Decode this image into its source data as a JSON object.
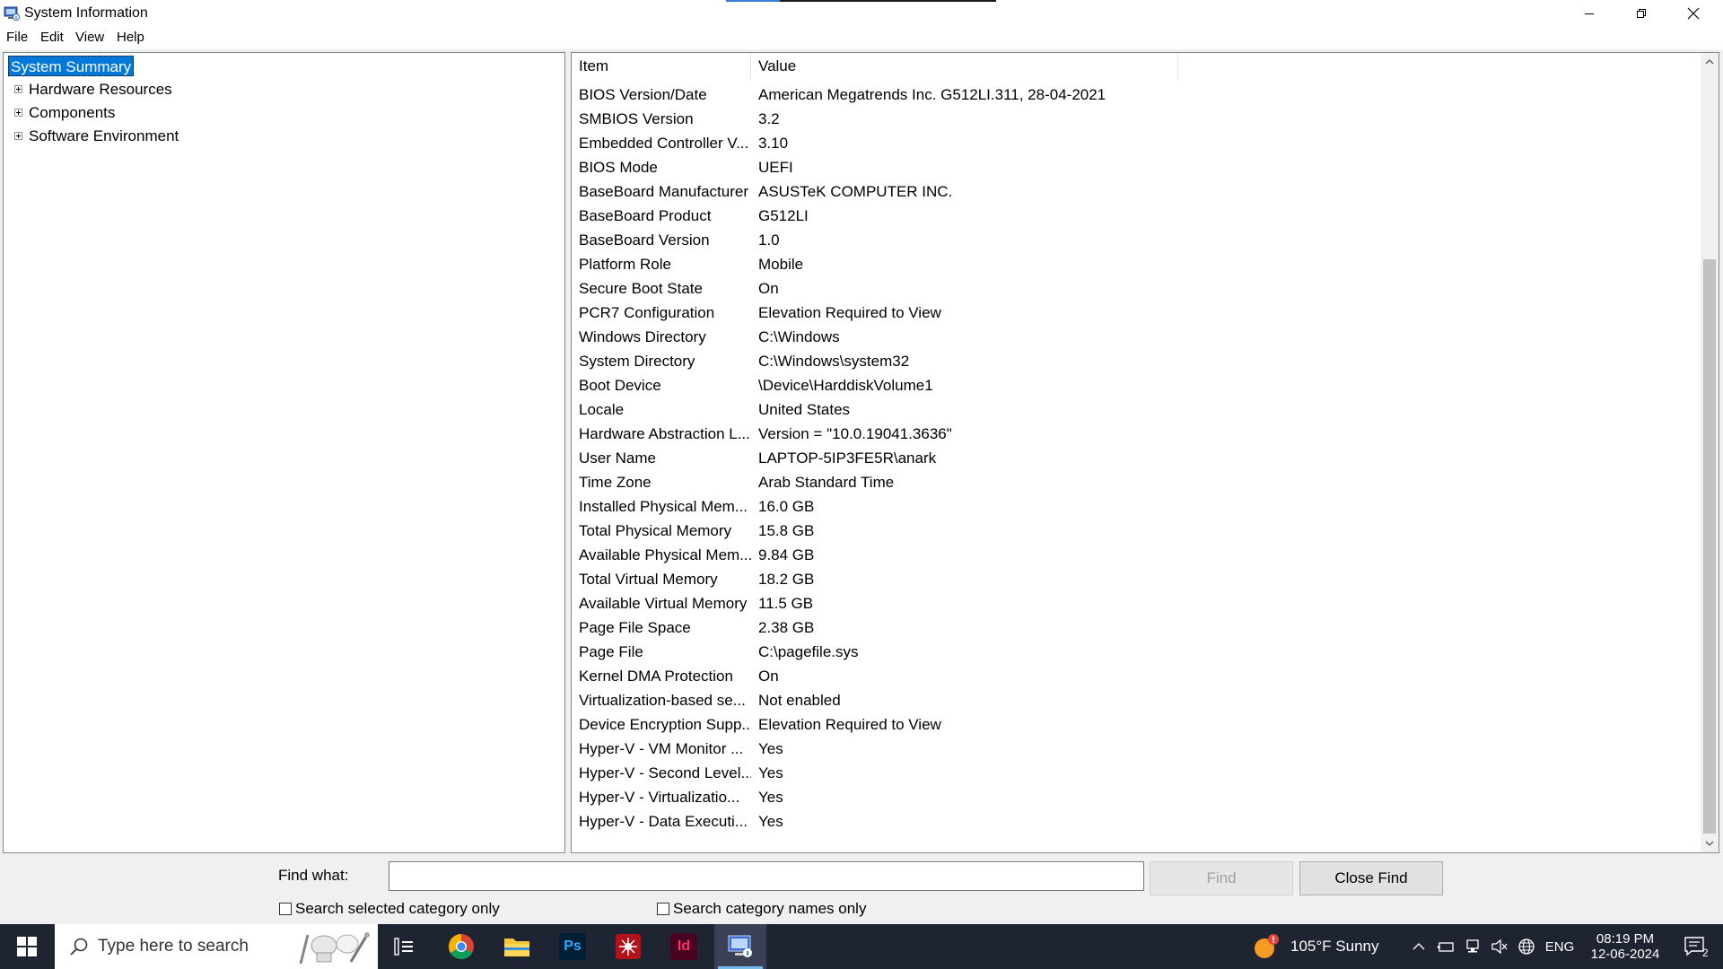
{
  "window": {
    "title": "System Information",
    "minimize": "—",
    "maximize": "❐",
    "close": "✕"
  },
  "menu": {
    "items": [
      "File",
      "Edit",
      "View",
      "Help"
    ]
  },
  "tree": {
    "root": "System Summary",
    "children": [
      "Hardware Resources",
      "Components",
      "Software Environment"
    ]
  },
  "list": {
    "headers": {
      "item": "Item",
      "value": "Value"
    },
    "rows": [
      {
        "item": "BIOS Version/Date",
        "value": "American Megatrends Inc. G512LI.311, 28-04-2021"
      },
      {
        "item": "SMBIOS Version",
        "value": "3.2"
      },
      {
        "item": "Embedded Controller V...",
        "value": "3.10"
      },
      {
        "item": "BIOS Mode",
        "value": "UEFI"
      },
      {
        "item": "BaseBoard Manufacturer",
        "value": "ASUSTeK COMPUTER INC."
      },
      {
        "item": "BaseBoard Product",
        "value": "G512LI"
      },
      {
        "item": "BaseBoard Version",
        "value": "1.0"
      },
      {
        "item": "Platform Role",
        "value": "Mobile"
      },
      {
        "item": "Secure Boot State",
        "value": "On"
      },
      {
        "item": "PCR7 Configuration",
        "value": "Elevation Required to View"
      },
      {
        "item": "Windows Directory",
        "value": "C:\\Windows"
      },
      {
        "item": "System Directory",
        "value": "C:\\Windows\\system32"
      },
      {
        "item": "Boot Device",
        "value": "\\Device\\HarddiskVolume1"
      },
      {
        "item": "Locale",
        "value": "United States"
      },
      {
        "item": "Hardware Abstraction L...",
        "value": "Version = \"10.0.19041.3636\""
      },
      {
        "item": "User Name",
        "value": "LAPTOP-5IP3FE5R\\anark"
      },
      {
        "item": "Time Zone",
        "value": "Arab Standard Time"
      },
      {
        "item": "Installed Physical Mem...",
        "value": "16.0 GB"
      },
      {
        "item": "Total Physical Memory",
        "value": "15.8 GB"
      },
      {
        "item": "Available Physical Mem...",
        "value": "9.84 GB"
      },
      {
        "item": "Total Virtual Memory",
        "value": "18.2 GB"
      },
      {
        "item": "Available Virtual Memory",
        "value": "11.5 GB"
      },
      {
        "item": "Page File Space",
        "value": "2.38 GB"
      },
      {
        "item": "Page File",
        "value": "C:\\pagefile.sys"
      },
      {
        "item": "Kernel DMA Protection",
        "value": "On"
      },
      {
        "item": "Virtualization-based se...",
        "value": "Not enabled"
      },
      {
        "item": "Device Encryption Supp...",
        "value": "Elevation Required to View"
      },
      {
        "item": "Hyper-V - VM Monitor ...",
        "value": "Yes"
      },
      {
        "item": "Hyper-V - Second Level...",
        "value": "Yes"
      },
      {
        "item": "Hyper-V - Virtualizatio...",
        "value": "Yes"
      },
      {
        "item": "Hyper-V - Data Executi...",
        "value": "Yes"
      }
    ]
  },
  "find": {
    "label": "Find what:",
    "value": "",
    "find_button": "Find",
    "close_find_button": "Close Find",
    "check_selected": "Search selected category only",
    "check_names": "Search category names only"
  },
  "taskbar": {
    "search_placeholder": "Type here to search",
    "apps": [
      "chrome",
      "file-explorer",
      "photoshop",
      "app-red",
      "indesign",
      "system-information"
    ],
    "photoshop_label": "Ps",
    "indesign_label": "Id",
    "weather": "105°F  Sunny",
    "language": "ENG",
    "time": "08:19 PM",
    "date": "12-06-2024",
    "notification_count": "2"
  },
  "colors": {
    "selection": "#0078d7",
    "taskbar": "#1f2433",
    "photoshop": "#31a8ff",
    "indesign": "#ff3366"
  }
}
